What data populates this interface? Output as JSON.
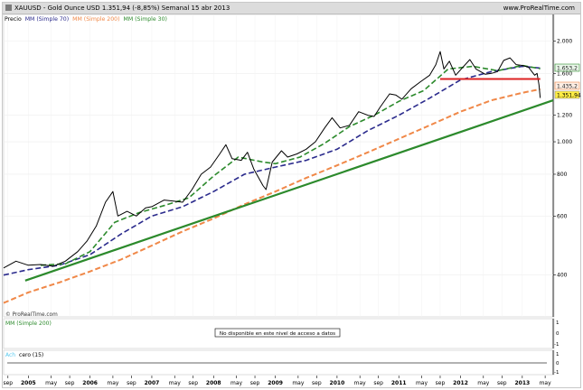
{
  "header": {
    "title": "XAUUSD - Gold Ounce USD    1.351,94 (-8,85%)      Semanal  15 abr 2013",
    "site": "www.ProRealTime.com"
  },
  "legend": {
    "price": "Precio",
    "mm70": "MM (Simple 70)",
    "mm200": "MM (Simple 200)",
    "mm30": "MM (Simple 30)"
  },
  "watermark": "© ProRealTime.com",
  "panel2": {
    "title": "MM (Simple 200)",
    "message": "No disponible en este nivel de acceso a datos",
    "ticks": [
      "1",
      "0",
      "-1"
    ]
  },
  "panel3": {
    "title_a": "Ach",
    "title_b": "cero (15)",
    "ticks": [
      "1",
      "0",
      "-1"
    ]
  },
  "value_labels": {
    "mm30": "1.653,2",
    "mm200": "1.435,2",
    "last": "1.351,94"
  },
  "colors": {
    "price": "#000000",
    "mm70": "#2a2a8c",
    "mm200": "#f08848",
    "mm30": "#2c8a2c",
    "trend": "#2c8a2c",
    "resistance": "#dd2222",
    "last_bg": "#ffee44"
  },
  "chart_data": {
    "type": "line",
    "scale": "log",
    "ylim": [
      300,
      2400
    ],
    "yticks": [
      {
        "v": 2000,
        "label": "2.000"
      },
      {
        "v": 1600,
        "label": "1.600"
      },
      {
        "v": 1200,
        "label": "1.200"
      },
      {
        "v": 1000,
        "label": "1.000"
      },
      {
        "v": 800,
        "label": "800"
      },
      {
        "v": 600,
        "label": "600"
      },
      {
        "v": 400,
        "label": "400"
      }
    ],
    "xlim": [
      2004.6,
      2013.5
    ],
    "xticks": [
      {
        "t": 2004.67,
        "label": "sep"
      },
      {
        "t": 2005.0,
        "label": "2005",
        "bold": true
      },
      {
        "t": 2005.37,
        "label": "may"
      },
      {
        "t": 2005.67,
        "label": "sep"
      },
      {
        "t": 2006.0,
        "label": "2006",
        "bold": true
      },
      {
        "t": 2006.37,
        "label": "may"
      },
      {
        "t": 2006.67,
        "label": "sep"
      },
      {
        "t": 2007.0,
        "label": "2007",
        "bold": true
      },
      {
        "t": 2007.37,
        "label": "may"
      },
      {
        "t": 2007.67,
        "label": "sep"
      },
      {
        "t": 2008.0,
        "label": "2008",
        "bold": true
      },
      {
        "t": 2008.37,
        "label": "may"
      },
      {
        "t": 2008.67,
        "label": "sep"
      },
      {
        "t": 2009.0,
        "label": "2009",
        "bold": true
      },
      {
        "t": 2009.37,
        "label": "may"
      },
      {
        "t": 2009.67,
        "label": "sep"
      },
      {
        "t": 2010.0,
        "label": "2010",
        "bold": true
      },
      {
        "t": 2010.37,
        "label": "may"
      },
      {
        "t": 2010.67,
        "label": "sep"
      },
      {
        "t": 2011.0,
        "label": "2011",
        "bold": true
      },
      {
        "t": 2011.37,
        "label": "may"
      },
      {
        "t": 2011.67,
        "label": "sep"
      },
      {
        "t": 2012.0,
        "label": "2012",
        "bold": true
      },
      {
        "t": 2012.37,
        "label": "may"
      },
      {
        "t": 2012.67,
        "label": "sep"
      },
      {
        "t": 2013.0,
        "label": "2013",
        "bold": true
      },
      {
        "t": 2013.37,
        "label": "may"
      }
    ],
    "series": [
      {
        "key": "price",
        "points": [
          [
            2004.6,
            420
          ],
          [
            2004.8,
            440
          ],
          [
            2005.0,
            428
          ],
          [
            2005.2,
            430
          ],
          [
            2005.4,
            425
          ],
          [
            2005.6,
            440
          ],
          [
            2005.8,
            470
          ],
          [
            2005.95,
            505
          ],
          [
            2006.1,
            560
          ],
          [
            2006.25,
            660
          ],
          [
            2006.37,
            710
          ],
          [
            2006.45,
            600
          ],
          [
            2006.6,
            620
          ],
          [
            2006.75,
            600
          ],
          [
            2006.9,
            635
          ],
          [
            2007.0,
            640
          ],
          [
            2007.2,
            670
          ],
          [
            2007.35,
            665
          ],
          [
            2007.5,
            660
          ],
          [
            2007.65,
            720
          ],
          [
            2007.8,
            800
          ],
          [
            2007.95,
            840
          ],
          [
            2008.1,
            920
          ],
          [
            2008.2,
            980
          ],
          [
            2008.3,
            890
          ],
          [
            2008.45,
            880
          ],
          [
            2008.55,
            930
          ],
          [
            2008.65,
            830
          ],
          [
            2008.8,
            740
          ],
          [
            2008.85,
            720
          ],
          [
            2008.95,
            870
          ],
          [
            2009.1,
            940
          ],
          [
            2009.2,
            900
          ],
          [
            2009.35,
            920
          ],
          [
            2009.5,
            950
          ],
          [
            2009.65,
            1000
          ],
          [
            2009.8,
            1100
          ],
          [
            2009.92,
            1180
          ],
          [
            2010.05,
            1100
          ],
          [
            2010.2,
            1120
          ],
          [
            2010.35,
            1230
          ],
          [
            2010.5,
            1200
          ],
          [
            2010.6,
            1190
          ],
          [
            2010.7,
            1270
          ],
          [
            2010.85,
            1390
          ],
          [
            2010.95,
            1380
          ],
          [
            2011.05,
            1340
          ],
          [
            2011.2,
            1440
          ],
          [
            2011.35,
            1510
          ],
          [
            2011.5,
            1580
          ],
          [
            2011.6,
            1700
          ],
          [
            2011.67,
            1860
          ],
          [
            2011.73,
            1650
          ],
          [
            2011.82,
            1740
          ],
          [
            2011.92,
            1580
          ],
          [
            2012.0,
            1640
          ],
          [
            2012.15,
            1760
          ],
          [
            2012.25,
            1650
          ],
          [
            2012.4,
            1590
          ],
          [
            2012.5,
            1600
          ],
          [
            2012.6,
            1620
          ],
          [
            2012.7,
            1750
          ],
          [
            2012.8,
            1780
          ],
          [
            2012.9,
            1700
          ],
          [
            2013.0,
            1690
          ],
          [
            2013.1,
            1670
          ],
          [
            2013.2,
            1580
          ],
          [
            2013.24,
            1600
          ],
          [
            2013.27,
            1480
          ],
          [
            2013.29,
            1351.94
          ]
        ]
      },
      {
        "key": "mm30",
        "points": [
          [
            2005.2,
            428
          ],
          [
            2005.6,
            432
          ],
          [
            2006.0,
            470
          ],
          [
            2006.4,
            575
          ],
          [
            2006.8,
            615
          ],
          [
            2007.2,
            645
          ],
          [
            2007.6,
            680
          ],
          [
            2008.0,
            790
          ],
          [
            2008.4,
            900
          ],
          [
            2008.8,
            870
          ],
          [
            2009.0,
            860
          ],
          [
            2009.4,
            900
          ],
          [
            2009.8,
            990
          ],
          [
            2010.2,
            1110
          ],
          [
            2010.6,
            1200
          ],
          [
            2011.0,
            1320
          ],
          [
            2011.4,
            1420
          ],
          [
            2011.8,
            1650
          ],
          [
            2012.2,
            1680
          ],
          [
            2012.6,
            1630
          ],
          [
            2013.0,
            1690
          ],
          [
            2013.29,
            1653.2
          ]
        ]
      },
      {
        "key": "mm70",
        "points": [
          [
            2004.6,
            400
          ],
          [
            2005.0,
            415
          ],
          [
            2005.5,
            428
          ],
          [
            2006.0,
            460
          ],
          [
            2006.5,
            530
          ],
          [
            2007.0,
            600
          ],
          [
            2007.5,
            640
          ],
          [
            2008.0,
            710
          ],
          [
            2008.5,
            800
          ],
          [
            2009.0,
            840
          ],
          [
            2009.5,
            880
          ],
          [
            2010.0,
            950
          ],
          [
            2010.5,
            1080
          ],
          [
            2011.0,
            1200
          ],
          [
            2011.5,
            1350
          ],
          [
            2012.0,
            1530
          ],
          [
            2012.5,
            1620
          ],
          [
            2013.0,
            1680
          ],
          [
            2013.29,
            1660
          ]
        ]
      },
      {
        "key": "mm200",
        "points": [
          [
            2004.6,
            330
          ],
          [
            2005.0,
            355
          ],
          [
            2005.5,
            380
          ],
          [
            2006.0,
            410
          ],
          [
            2006.5,
            445
          ],
          [
            2007.0,
            490
          ],
          [
            2007.5,
            540
          ],
          [
            2008.0,
            590
          ],
          [
            2008.5,
            650
          ],
          [
            2009.0,
            710
          ],
          [
            2009.5,
            780
          ],
          [
            2010.0,
            850
          ],
          [
            2010.5,
            930
          ],
          [
            2011.0,
            1020
          ],
          [
            2011.5,
            1120
          ],
          [
            2012.0,
            1230
          ],
          [
            2012.5,
            1330
          ],
          [
            2013.0,
            1400
          ],
          [
            2013.29,
            1435.2
          ]
        ]
      },
      {
        "key": "trend",
        "points": [
          [
            2004.95,
            385
          ],
          [
            2013.5,
            1330
          ]
        ]
      },
      {
        "key": "resistance",
        "points": [
          [
            2011.67,
            1540
          ],
          [
            2013.29,
            1540
          ]
        ]
      }
    ]
  }
}
